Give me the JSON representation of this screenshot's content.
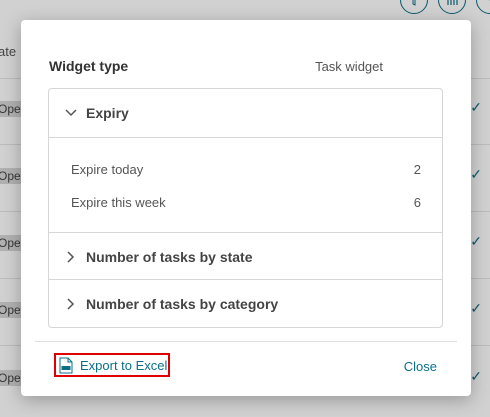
{
  "background": {
    "column_header": "ate",
    "state_badge": "Ope",
    "check_mark": "✓"
  },
  "dialog": {
    "widget_type_label": "Widget type",
    "widget_type_value": "Task widget",
    "sections": [
      {
        "title": "Expiry",
        "expanded": true,
        "rows": [
          {
            "label": "Expire today",
            "value": "2"
          },
          {
            "label": "Expire this week",
            "value": "6"
          }
        ]
      },
      {
        "title": "Number of tasks by state",
        "expanded": false
      },
      {
        "title": "Number of tasks by category",
        "expanded": false
      }
    ],
    "footer": {
      "export_label": "Export to Excel",
      "close_label": "Close"
    }
  },
  "colors": {
    "accent": "#0d6f86",
    "highlight_border": "#e00000"
  }
}
